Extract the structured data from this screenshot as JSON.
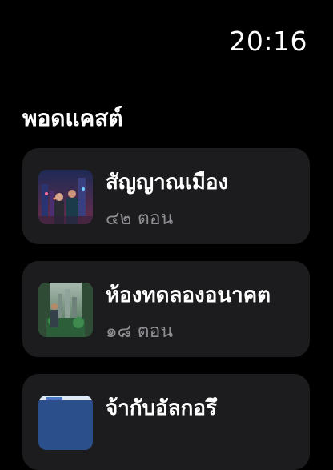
{
  "status_bar": {
    "time": "20:16"
  },
  "section": {
    "title": "พอดแคสต์"
  },
  "podcasts": [
    {
      "title": "สัญญาณเมือง",
      "episodes": "๔๒ ตอน",
      "artwork": "city-night-couple-artwork"
    },
    {
      "title": "ห้องทดลองอนาคต",
      "episodes": "๑๘ ตอน",
      "artwork": "futuristic-lab-artwork"
    },
    {
      "title": "จ้ากับอัลกอรึ",
      "episodes": "",
      "artwork": "blue-artwork"
    }
  ],
  "colors": {
    "background": "#000000",
    "card": "#1c1c1e",
    "secondary_text": "#8e8e93"
  }
}
